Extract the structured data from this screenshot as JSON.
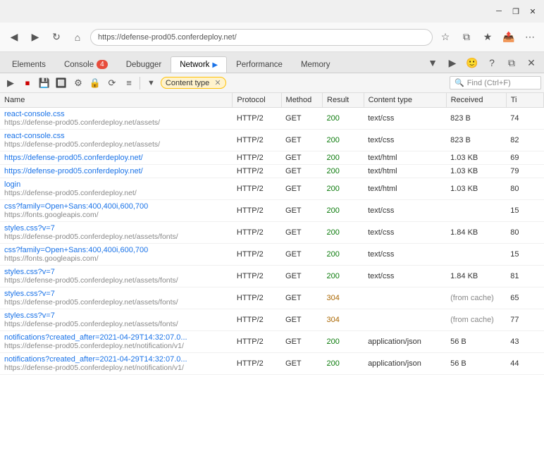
{
  "titlebar": {
    "minimize_label": "─",
    "maximize_label": "❐",
    "close_label": "✕"
  },
  "browser_toolbar": {
    "icons": [
      "⬅",
      "➡",
      "↻",
      "🏠",
      "⭐",
      "👁",
      "📤",
      "⋯"
    ]
  },
  "devtools": {
    "tabs": [
      {
        "id": "elements",
        "label": "Elements",
        "active": false,
        "badge": null
      },
      {
        "id": "console",
        "label": "Console",
        "active": false,
        "badge": "4"
      },
      {
        "id": "debugger",
        "label": "Debugger",
        "active": false,
        "badge": null
      },
      {
        "id": "network",
        "label": "Network",
        "active": true,
        "badge": null
      },
      {
        "id": "performance",
        "label": "Performance",
        "active": false,
        "badge": null
      },
      {
        "id": "memory",
        "label": "Memory",
        "active": false,
        "badge": null
      }
    ],
    "right_icons": [
      "▼",
      "▶",
      "🙂",
      "?",
      "⧉",
      "✕"
    ]
  },
  "network_toolbar": {
    "buttons": [
      "▶",
      "⏹",
      "💾",
      "🔲",
      "⚙",
      "🔒",
      "⟳",
      "≡"
    ],
    "filter_label": "Content type",
    "find_placeholder": "Find (Ctrl+F)"
  },
  "table": {
    "headers": [
      "Name",
      "Protocol",
      "Method",
      "Result",
      "Content type",
      "Received",
      "Ti"
    ],
    "rows": [
      {
        "name": "react-console.css",
        "url": "https://defense-prod05.conferdeploy.net/assets/",
        "protocol": "HTTP/2",
        "method": "GET",
        "result": "200",
        "content_type": "text/css",
        "received": "823 B",
        "time": "74"
      },
      {
        "name": "react-console.css",
        "url": "https://defense-prod05.conferdeploy.net/assets/",
        "protocol": "HTTP/2",
        "method": "GET",
        "result": "200",
        "content_type": "text/css",
        "received": "823 B",
        "time": "82"
      },
      {
        "name": "https://defense-prod05.conferdeploy.net/",
        "url": "",
        "protocol": "HTTP/2",
        "method": "GET",
        "result": "200",
        "content_type": "text/html",
        "received": "1.03 KB",
        "time": "69"
      },
      {
        "name": "https://defense-prod05.conferdeploy.net/",
        "url": "",
        "protocol": "HTTP/2",
        "method": "GET",
        "result": "200",
        "content_type": "text/html",
        "received": "1.03 KB",
        "time": "79"
      },
      {
        "name": "login",
        "url": "https://defense-prod05.conferdeploy.net/",
        "protocol": "HTTP/2",
        "method": "GET",
        "result": "200",
        "content_type": "text/html",
        "received": "1.03 KB",
        "time": "80"
      },
      {
        "name": "css?family=Open+Sans:400,400i,600,700",
        "url": "https://fonts.googleapis.com/",
        "protocol": "HTTP/2",
        "method": "GET",
        "result": "200",
        "content_type": "text/css",
        "received": "",
        "time": "15"
      },
      {
        "name": "styles.css?v=7",
        "url": "https://defense-prod05.conferdeploy.net/assets/fonts/",
        "protocol": "HTTP/2",
        "method": "GET",
        "result": "200",
        "content_type": "text/css",
        "received": "1.84 KB",
        "time": "80"
      },
      {
        "name": "css?family=Open+Sans:400,400i,600,700",
        "url": "https://fonts.googleapis.com/",
        "protocol": "HTTP/2",
        "method": "GET",
        "result": "200",
        "content_type": "text/css",
        "received": "",
        "time": "15"
      },
      {
        "name": "styles.css?v=7",
        "url": "https://defense-prod05.conferdeploy.net/assets/fonts/",
        "protocol": "HTTP/2",
        "method": "GET",
        "result": "200",
        "content_type": "text/css",
        "received": "1.84 KB",
        "time": "81"
      },
      {
        "name": "styles.css?v=7",
        "url": "https://defense-prod05.conferdeploy.net/assets/fonts/",
        "protocol": "HTTP/2",
        "method": "GET",
        "result": "304",
        "content_type": "",
        "received": "(from cache)",
        "time": "65"
      },
      {
        "name": "styles.css?v=7",
        "url": "https://defense-prod05.conferdeploy.net/assets/fonts/",
        "protocol": "HTTP/2",
        "method": "GET",
        "result": "304",
        "content_type": "",
        "received": "(from cache)",
        "time": "77"
      },
      {
        "name": "notifications?created_after=2021-04-29T14:32:07.0...",
        "url": "https://defense-prod05.conferdeploy.net/notification/v1/",
        "protocol": "HTTP/2",
        "method": "GET",
        "result": "200",
        "content_type": "application/json",
        "received": "56 B",
        "time": "43"
      },
      {
        "name": "notifications?created_after=2021-04-29T14:32:07.0...",
        "url": "https://defense-prod05.conferdeploy.net/notification/v1/",
        "protocol": "HTTP/2",
        "method": "GET",
        "result": "200",
        "content_type": "application/json",
        "received": "56 B",
        "time": "44"
      }
    ]
  }
}
